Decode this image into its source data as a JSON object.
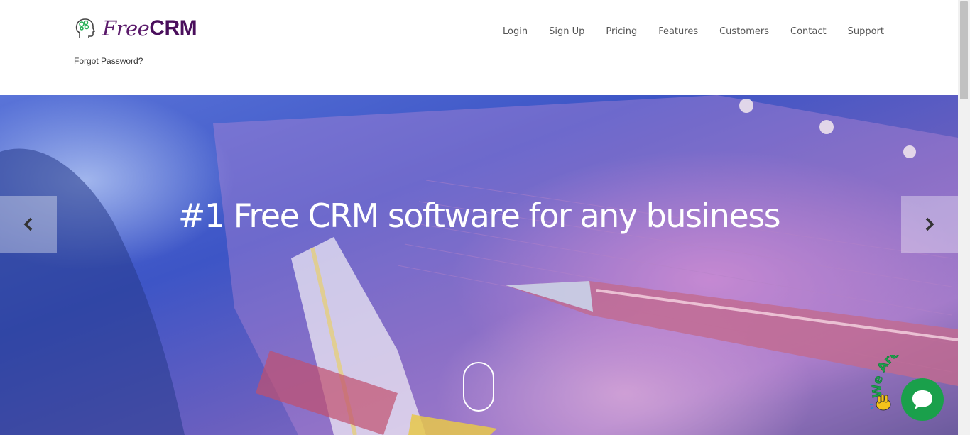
{
  "brand": {
    "name_part1": "Free",
    "name_part2": "CRM"
  },
  "header": {
    "forgot_password": "Forgot Password?"
  },
  "nav": {
    "login": "Login",
    "signup": "Sign Up",
    "pricing": "Pricing",
    "features": "Features",
    "customers": "Customers",
    "contact": "Contact",
    "support": "Support"
  },
  "hero": {
    "title": "#1 Free CRM software for any business",
    "prev_icon": "chevron-left-icon",
    "next_icon": "chevron-right-icon",
    "scroll_icon": "mouse-scroll-icon"
  },
  "chat": {
    "badge_text": "We Are Here!",
    "icon": "chat-bubble-icon"
  },
  "colors": {
    "brand_purple": "#4a0f5c",
    "nav_text": "#555555",
    "chat_green": "#1aa04b"
  }
}
